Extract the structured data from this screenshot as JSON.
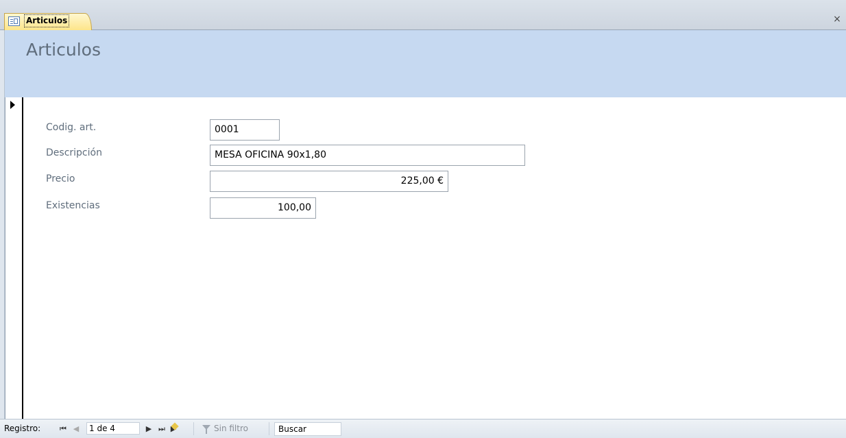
{
  "tab": {
    "label": "Articulos",
    "close": "×"
  },
  "form": {
    "title": "Articulos",
    "fields": {
      "codigo": {
        "label": "Codig. art.",
        "value": "0001"
      },
      "descripcion": {
        "label": "Descripción",
        "value": "MESA OFICINA 90x1,80"
      },
      "precio": {
        "label": "Precio",
        "value": "225,00 €"
      },
      "existencias": {
        "label": "Existencias",
        "value": "100,00"
      }
    }
  },
  "navbar": {
    "label": "Registro:",
    "first": "⏮",
    "prev": "◀",
    "record": "1 de 4",
    "next": "▶",
    "last": "⏭",
    "new": "▶",
    "filter": "Sin filtro",
    "search": "Buscar"
  }
}
